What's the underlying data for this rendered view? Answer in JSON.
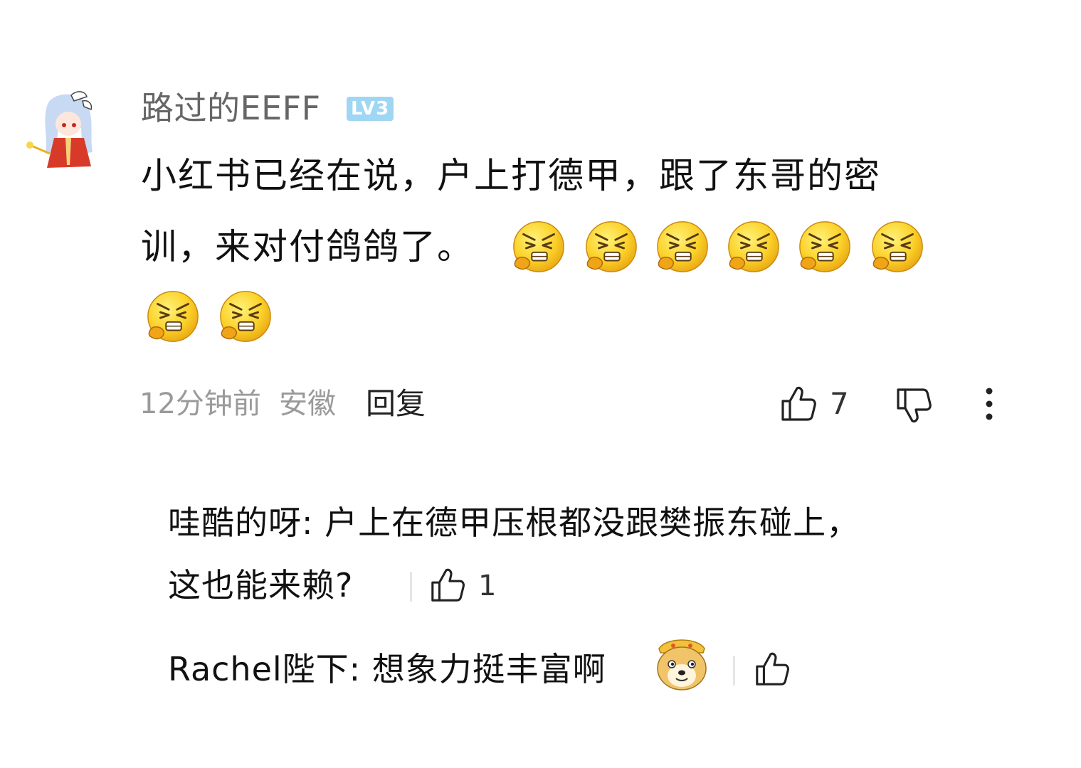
{
  "comment": {
    "author": {
      "name": "路过的EEFF",
      "level_badge": "LV3",
      "avatar_icon": "anime-girl-avatar-icon"
    },
    "text_line1": "小红书已经在说，户上打德甲，跟了东哥的密",
    "text_line2": "训，来对付鸽鸽了。",
    "emoji_icon": "angry-cough-face-icon",
    "emoji_count": 8,
    "time": "12分钟前",
    "location": "安徽",
    "reply_label": "回复",
    "like_count": "7",
    "icons": {
      "like": "thumbs-up-icon",
      "dislike": "thumbs-down-icon",
      "more": "more-vertical-icon"
    }
  },
  "replies": [
    {
      "line1": "哇酷的呀: 户上在德甲压根都没跟樊振东碰上，",
      "line2": "这也能来赖?",
      "like_count": "1"
    },
    {
      "line1": "Rachel陛下: 想象力挺丰富啊",
      "emoji_icon": "doge-monkey-king-icon",
      "like_count": ""
    }
  ],
  "colors": {
    "background": "#ffffff",
    "primary_text": "#111111",
    "username": "#666666",
    "meta": "#9a9a9a",
    "badge": "#9fd6f3",
    "emoji_yellow": "#f9c825"
  }
}
